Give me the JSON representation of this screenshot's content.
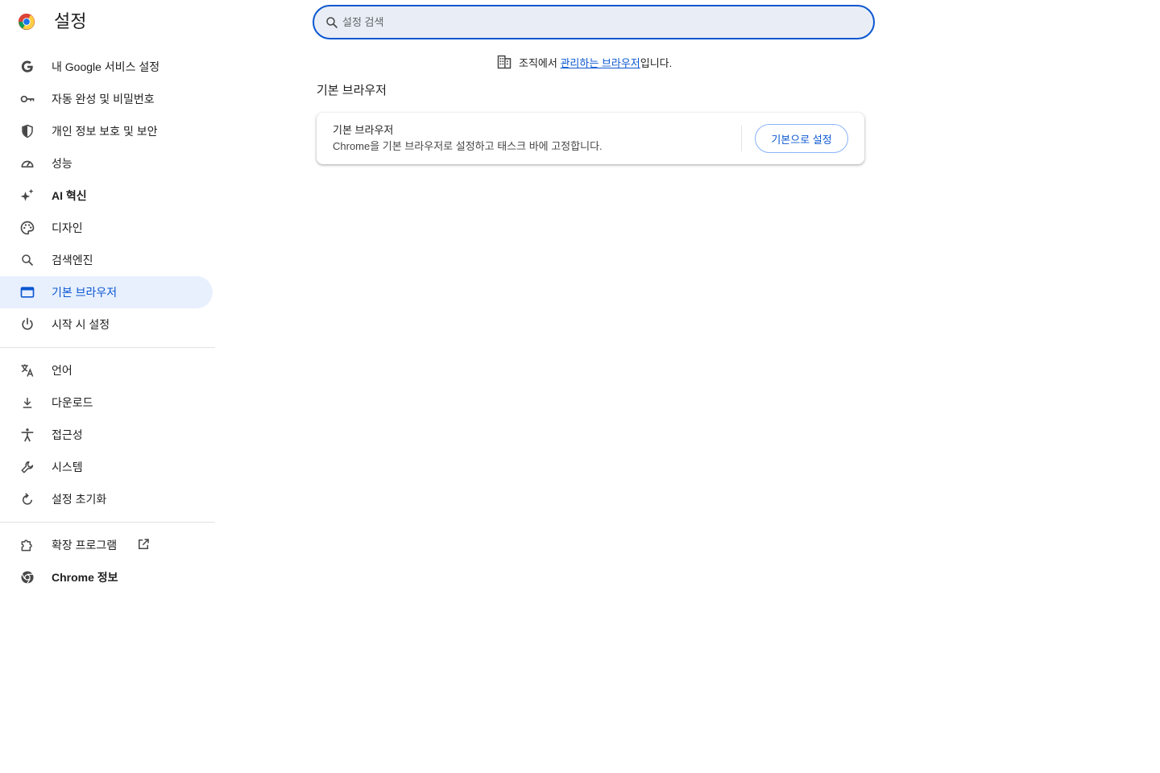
{
  "header": {
    "title": "설정",
    "search_placeholder": "설정 검색"
  },
  "sidebar": {
    "items": [
      {
        "label": "내 Google 서비스 설정",
        "icon": "google-g-icon"
      },
      {
        "label": "자동 완성 및 비밀번호",
        "icon": "key-icon"
      },
      {
        "label": "개인 정보 보호 및 보안",
        "icon": "shield-icon"
      },
      {
        "label": "성능",
        "icon": "speedometer-icon"
      },
      {
        "label": "AI 혁신",
        "icon": "sparkle-icon"
      },
      {
        "label": "디자인",
        "icon": "palette-icon"
      },
      {
        "label": "검색엔진",
        "icon": "search-icon"
      },
      {
        "label": "기본 브라우저",
        "icon": "browser-window-icon",
        "active": true
      },
      {
        "label": "시작 시 설정",
        "icon": "power-icon"
      }
    ],
    "items2": [
      {
        "label": "언어",
        "icon": "translate-icon"
      },
      {
        "label": "다운로드",
        "icon": "download-icon"
      },
      {
        "label": "접근성",
        "icon": "accessibility-icon"
      },
      {
        "label": "시스템",
        "icon": "wrench-icon"
      },
      {
        "label": "설정 초기화",
        "icon": "reset-icon"
      }
    ],
    "items3": [
      {
        "label": "확장 프로그램",
        "icon": "puzzle-icon",
        "external_icon": "open-in-new-icon"
      },
      {
        "label": "Chrome 정보",
        "icon": "chrome-icon"
      }
    ]
  },
  "managed_notice": {
    "prefix": "조직에서 ",
    "link": "관리하는 브라우저",
    "suffix": "입니다."
  },
  "main": {
    "section_title": "기본 브라우저",
    "card": {
      "title": "기본 브라우저",
      "description": "Chrome을 기본 브라우저로 설정하고 태스크 바에 고정합니다.",
      "button_label": "기본으로 설정"
    }
  },
  "colors": {
    "accent": "#0b57d0",
    "active_bg": "#e8f0fe",
    "search_bg": "#e9eef6"
  }
}
